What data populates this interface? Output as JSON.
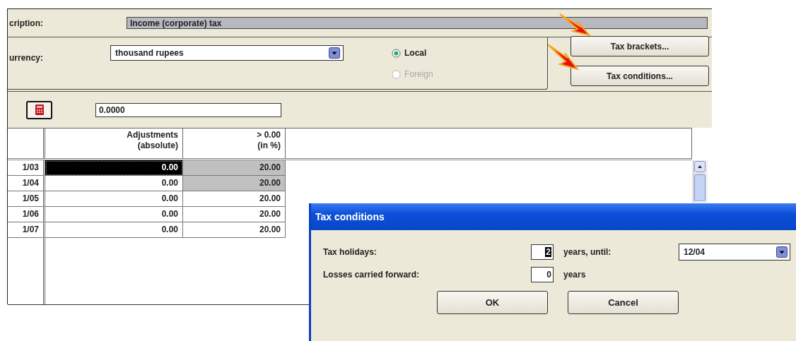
{
  "description": {
    "label": "cription:",
    "value": "Income (corporate) tax"
  },
  "currency": {
    "label": "urrency:",
    "value": "thousand rupees",
    "options": [
      {
        "label": "Local",
        "selected": true,
        "disabled": false
      },
      {
        "label": "Foreign",
        "selected": false,
        "disabled": true
      }
    ]
  },
  "buttons": [
    "Tax brackets...",
    "Tax conditions..."
  ],
  "rate_field": {
    "value": "0.0000"
  },
  "table": {
    "columns": [
      "Adjustments\n(absolute)",
      "> 0.00\n(in %)"
    ],
    "rows": [
      {
        "period": "1/03",
        "adjustment": "0.00",
        "rate": "20.00",
        "selected": true,
        "rate_highlighted": true
      },
      {
        "period": "1/04",
        "adjustment": "0.00",
        "rate": "20.00",
        "selected": false,
        "rate_highlighted": true
      },
      {
        "period": "1/05",
        "adjustment": "0.00",
        "rate": "20.00",
        "selected": false,
        "rate_highlighted": false
      },
      {
        "period": "1/06",
        "adjustment": "0.00",
        "rate": "20.00",
        "selected": false,
        "rate_highlighted": false
      },
      {
        "period": "1/07",
        "adjustment": "0.00",
        "rate": "20.00",
        "selected": false,
        "rate_highlighted": false
      }
    ]
  },
  "dialog": {
    "title": "Tax conditions",
    "holidays": {
      "label": "Tax holidays:",
      "value": "2",
      "unit": "years, until:",
      "until": "12/04"
    },
    "losses": {
      "label": "Losses carried forward:",
      "value": "0",
      "unit": "years"
    },
    "buttons": [
      "OK",
      "Cancel"
    ]
  }
}
